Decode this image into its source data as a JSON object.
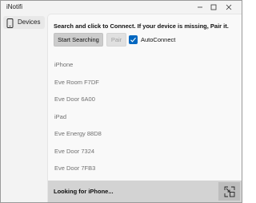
{
  "window": {
    "title": "iNotifi"
  },
  "sidebar": {
    "items": [
      {
        "label": "Devices",
        "icon": "phone-icon"
      }
    ]
  },
  "main": {
    "instructions": "Search and click to Connect. If your device is missing, Pair it.",
    "start_search_label": "Start Searching",
    "pair_label": "Pair",
    "autoconnect_label": "AutoConnect",
    "autoconnect_checked": true,
    "devices": [
      "iPhone",
      "Eve Room F7DF",
      "Eve Door 6A00",
      "iPad",
      "Eve Energy 88D8",
      "Eve Door 7324",
      "Eve Door 7FB3"
    ]
  },
  "footer": {
    "status": "Looking for iPhone...",
    "button_icon": "compact-overlay-icon"
  },
  "colors": {
    "accent": "#0067c0",
    "footer_bg": "#d3d3d3",
    "footer_button_bg": "#bdbdbd",
    "device_text": "#707070"
  }
}
